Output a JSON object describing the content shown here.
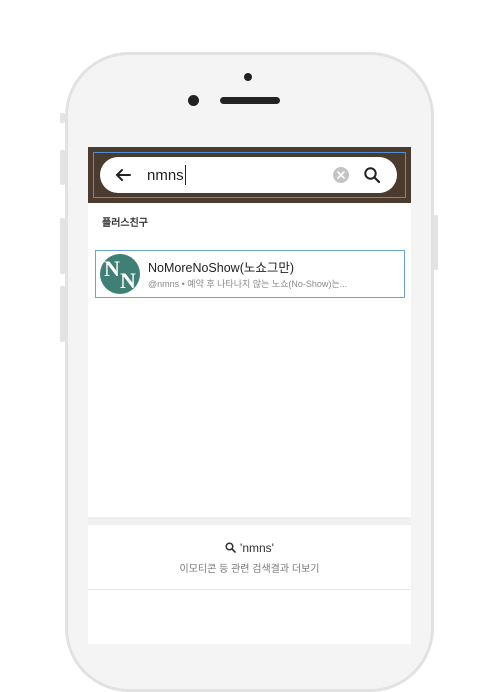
{
  "search": {
    "query": "nmns",
    "placeholder": ""
  },
  "section": {
    "label": "플러스친구"
  },
  "results": [
    {
      "title": "NoMoreNoShow(노쇼그만)",
      "subtitle": "@nmns • 예약 후 나타나지 않는 노쇼(No-Show)는...",
      "avatar_letters": [
        "N",
        "N"
      ]
    }
  ],
  "more": {
    "query_label": "'nmns'",
    "description": "이모티콘 등 관련 검색결과 더보기"
  },
  "colors": {
    "search_bar_bg": "#4a3b2e",
    "avatar_bg": "#3f7f74",
    "highlight_border": "#6aa3d8"
  },
  "icons": [
    "back-arrow-icon",
    "clear-icon",
    "search-icon",
    "magnifier-icon"
  ]
}
